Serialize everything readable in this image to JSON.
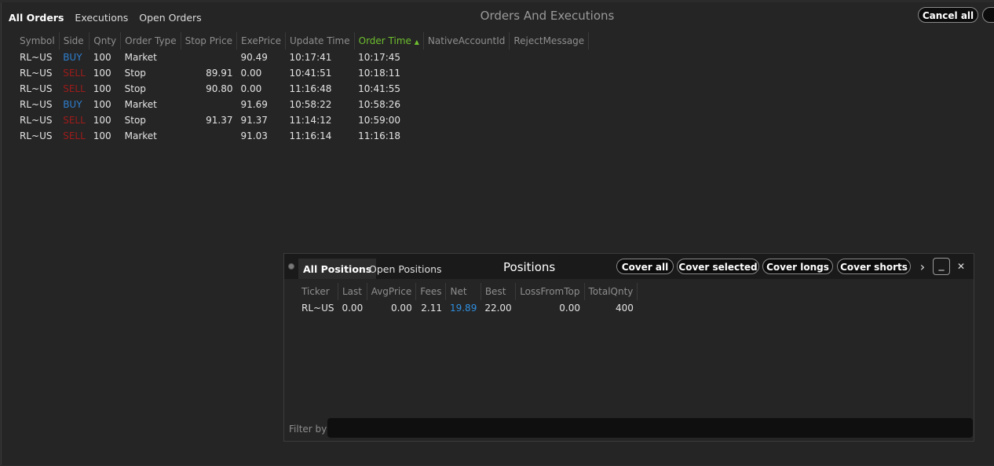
{
  "orders_window": {
    "tabs": [
      "All Orders",
      "Executions",
      "Open Orders"
    ],
    "title": "Orders And Executions",
    "cancel_all_label": "Cancel all",
    "columns": [
      "Symbol",
      "Side",
      "Qnty",
      "Order Type",
      "Stop Price",
      "ExePrice",
      "Update Time",
      "Order Time",
      "NativeAccountId",
      "RejectMessage"
    ],
    "sorted_column": "Order Time",
    "rows": [
      {
        "symbol": "RL~US",
        "side": "BUY",
        "qnty": "100",
        "order_type": "Market",
        "stop_price": "",
        "exe_price": "90.49",
        "update_time": "10:17:41",
        "order_time": "10:17:45"
      },
      {
        "symbol": "RL~US",
        "side": "SELL",
        "qnty": "100",
        "order_type": "Stop",
        "stop_price": "89.91",
        "exe_price": "0.00",
        "update_time": "10:41:51",
        "order_time": "10:18:11"
      },
      {
        "symbol": "RL~US",
        "side": "SELL",
        "qnty": "100",
        "order_type": "Stop",
        "stop_price": "90.80",
        "exe_price": "0.00",
        "update_time": "11:16:48",
        "order_time": "10:41:55"
      },
      {
        "symbol": "RL~US",
        "side": "BUY",
        "qnty": "100",
        "order_type": "Market",
        "stop_price": "",
        "exe_price": "91.69",
        "update_time": "10:58:22",
        "order_time": "10:58:26"
      },
      {
        "symbol": "RL~US",
        "side": "SELL",
        "qnty": "100",
        "order_type": "Stop",
        "stop_price": "91.37",
        "exe_price": "91.37",
        "update_time": "11:14:12",
        "order_time": "10:59:00"
      },
      {
        "symbol": "RL~US",
        "side": "SELL",
        "qnty": "100",
        "order_type": "Market",
        "stop_price": "",
        "exe_price": "91.03",
        "update_time": "11:16:14",
        "order_time": "11:16:18"
      }
    ]
  },
  "positions_window": {
    "tabs": [
      "All Positions",
      "Open Positions"
    ],
    "title": "Positions",
    "buttons": [
      "Cover all",
      "Cover selected",
      "Cover longs",
      "Cover shorts"
    ],
    "more_icon": "›",
    "minimize_icon": "_",
    "close_icon": "✕",
    "columns": [
      "Ticker",
      "Last",
      "AvgPrice",
      "Fees",
      "Net",
      "Best",
      "LossFromTop",
      "TotalQnty"
    ],
    "rows": [
      {
        "ticker": "RL~US",
        "last": "0.00",
        "avg_price": "0.00",
        "fees": "2.11",
        "net": "19.89",
        "best": "22.00",
        "loss_from_top": "0.00",
        "total_qnty": "400"
      }
    ],
    "filter_label": "Filter by",
    "filter_value": ""
  },
  "colors": {
    "buy": "#2f7fcf",
    "sell": "#9e1b1b",
    "sorted_header": "#6fbf2f",
    "net_positive": "#2f8fe0"
  }
}
